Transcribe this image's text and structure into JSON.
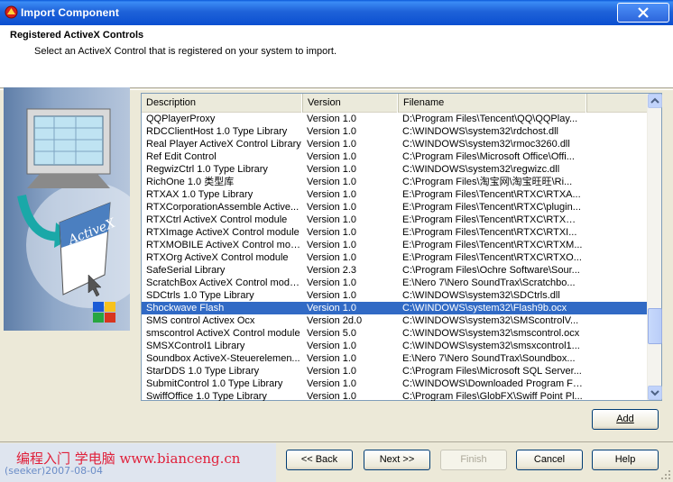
{
  "window": {
    "title": "Import Component"
  },
  "header": {
    "title": "Registered ActiveX Controls",
    "subtitle": "Select an ActiveX Control that is registered on your system to import."
  },
  "art": {
    "label": "ActiveX"
  },
  "list": {
    "columns": [
      "Description",
      "Version",
      "Filename"
    ],
    "rows": [
      {
        "desc": "QQPlayerProxy",
        "ver": "Version 1.0",
        "file": "D:\\Program Files\\Tencent\\QQ\\QQPlay..."
      },
      {
        "desc": "RDCClientHost 1.0 Type Library",
        "ver": "Version 1.0",
        "file": "C:\\WINDOWS\\system32\\rdchost.dll"
      },
      {
        "desc": "Real Player ActiveX Control Library",
        "ver": "Version 1.0",
        "file": "C:\\WINDOWS\\system32\\rmoc3260.dll"
      },
      {
        "desc": "Ref Edit Control",
        "ver": "Version 1.0",
        "file": "C:\\Program Files\\Microsoft Office\\Offi..."
      },
      {
        "desc": "RegwizCtrl 1.0 Type Library",
        "ver": "Version 1.0",
        "file": "C:\\WINDOWS\\system32\\regwizc.dll"
      },
      {
        "desc": "RichOne 1.0 类型库",
        "ver": "Version 1.0",
        "file": "C:\\Program Files\\淘宝网\\淘宝旺旺\\Ri..."
      },
      {
        "desc": "RTXAX 1.0 Type Library",
        "ver": "Version 1.0",
        "file": "E:\\Program Files\\Tencent\\RTXC\\RTXA..."
      },
      {
        "desc": "RTXCorporationAssemble Active...",
        "ver": "Version 1.0",
        "file": "E:\\Program Files\\Tencent\\RTXC\\plugin..."
      },
      {
        "desc": "RTXCtrl ActiveX Control module",
        "ver": "Version 1.0",
        "file": "E:\\Program Files\\Tencent\\RTXC\\RTXCt..."
      },
      {
        "desc": "RTXImage ActiveX Control module",
        "ver": "Version 1.0",
        "file": "E:\\Program Files\\Tencent\\RTXC\\RTXI..."
      },
      {
        "desc": "RTXMOBILE ActiveX Control module",
        "ver": "Version 1.0",
        "file": "E:\\Program Files\\Tencent\\RTXC\\RTXM..."
      },
      {
        "desc": "RTXOrg ActiveX Control module",
        "ver": "Version 1.0",
        "file": "E:\\Program Files\\Tencent\\RTXC\\RTXO..."
      },
      {
        "desc": "SafeSerial Library",
        "ver": "Version 2.3",
        "file": "C:\\Program Files\\Ochre Software\\Sour..."
      },
      {
        "desc": "ScratchBox ActiveX Control module",
        "ver": "Version 1.0",
        "file": "E:\\Nero 7\\Nero SoundTrax\\Scratchbo..."
      },
      {
        "desc": "SDCtrls 1.0 Type Library",
        "ver": "Version 1.0",
        "file": "C:\\WINDOWS\\system32\\SDCtrls.dll"
      },
      {
        "desc": "Shockwave Flash",
        "ver": "Version 1.0",
        "file": "C:\\WINDOWS\\system32\\Flash9b.ocx",
        "selected": true
      },
      {
        "desc": "SMS control Activex Ocx",
        "ver": "Version 2d.0",
        "file": "C:\\WINDOWS\\system32\\SMScontrolV..."
      },
      {
        "desc": "smscontrol ActiveX Control module",
        "ver": "Version 5.0",
        "file": "C:\\WINDOWS\\system32\\smscontrol.ocx"
      },
      {
        "desc": "SMSXControl1 Library",
        "ver": "Version 1.0",
        "file": "C:\\WINDOWS\\system32\\smsxcontrol1..."
      },
      {
        "desc": "Soundbox ActiveX-Steuerelemen...",
        "ver": "Version 1.0",
        "file": "E:\\Nero 7\\Nero SoundTrax\\Soundbox..."
      },
      {
        "desc": "StarDDS 1.0 Type Library",
        "ver": "Version 1.0",
        "file": "C:\\Program Files\\Microsoft SQL Server..."
      },
      {
        "desc": "SubmitControl 1.0 Type Library",
        "ver": "Version 1.0",
        "file": "C:\\WINDOWS\\Downloaded Program Fi..."
      },
      {
        "desc": "SwiffOffice 1.0 Type Library",
        "ver": "Version 1.0",
        "file": "C:\\Program Files\\GlobFX\\Swiff Point Pl..."
      }
    ]
  },
  "buttons": {
    "add": "Add",
    "back": "<< Back",
    "next": "Next >>",
    "finish": "Finish",
    "cancel": "Cancel",
    "help": "Help"
  },
  "watermark": {
    "line1": "编程入门 学电脑 www.bianceng.cn",
    "line2": "(seeker)2007-08-04"
  }
}
